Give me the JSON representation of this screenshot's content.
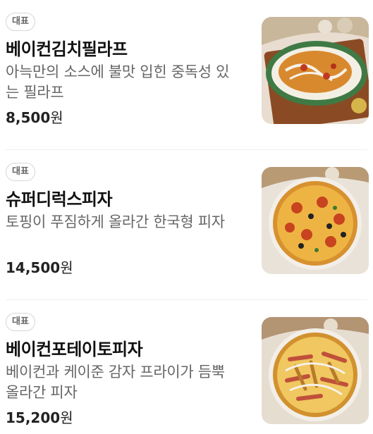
{
  "menu": {
    "items": [
      {
        "badge": "대표",
        "name": "베이컨김치필라프",
        "description": "아늑만의 소스에 불맛 입힌 중독성 있는 필라프",
        "price": "8,500",
        "price_unit": "원",
        "image_icon": "pilaf-dish-photo"
      },
      {
        "badge": "대표",
        "name": "슈퍼디럭스피자",
        "description": "토핑이 푸짐하게 올라간 한국형 피자",
        "price": "14,500",
        "price_unit": "원",
        "image_icon": "supreme-pizza-photo"
      },
      {
        "badge": "대표",
        "name": "베이컨포테이토피자",
        "description": "베이컨과 케이준 감자 프라이가 듬뿍 올라간 피자",
        "price": "15,200",
        "price_unit": "원",
        "image_icon": "bacon-potato-pizza-photo"
      }
    ]
  }
}
